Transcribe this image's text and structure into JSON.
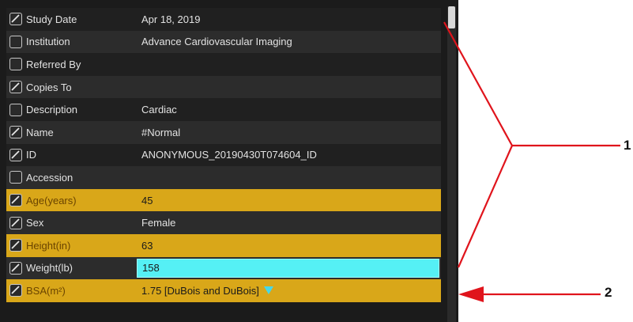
{
  "rows": [
    {
      "checked": true,
      "label": "Study Date",
      "value": "Apr 18, 2019",
      "highlight": false
    },
    {
      "checked": false,
      "label": "Institution",
      "value": "Advance Cardiovascular Imaging",
      "highlight": false
    },
    {
      "checked": false,
      "label": "Referred By",
      "value": "",
      "highlight": false
    },
    {
      "checked": true,
      "label": "Copies To",
      "value": "",
      "highlight": false
    },
    {
      "checked": false,
      "label": "Description",
      "value": "Cardiac",
      "highlight": false
    },
    {
      "checked": true,
      "label": "Name",
      "value": "#Normal",
      "highlight": false
    },
    {
      "checked": true,
      "label": "ID",
      "value": "ANONYMOUS_20190430T074604_ID",
      "highlight": false
    },
    {
      "checked": false,
      "label": "Accession",
      "value": "",
      "highlight": false
    },
    {
      "checked": true,
      "label": "Age(years)",
      "value": "45",
      "highlight": true
    },
    {
      "checked": true,
      "label": "Sex",
      "value": "Female",
      "highlight": false
    },
    {
      "checked": true,
      "label": "Height(in)",
      "value": "63",
      "highlight": true
    },
    {
      "checked": true,
      "label": "Weight(lb)",
      "value": "158",
      "highlight": false,
      "editing": true
    },
    {
      "checked": true,
      "label": "BSA(m²)",
      "value": "1.75 [DuBois and DuBois]",
      "highlight": true,
      "dropdown": true
    }
  ],
  "callouts": [
    {
      "number": "1"
    },
    {
      "number": "2"
    }
  ],
  "colors": {
    "highlight": "#d9a719",
    "editing": "#55f0f5",
    "callout": "#e0141c"
  }
}
